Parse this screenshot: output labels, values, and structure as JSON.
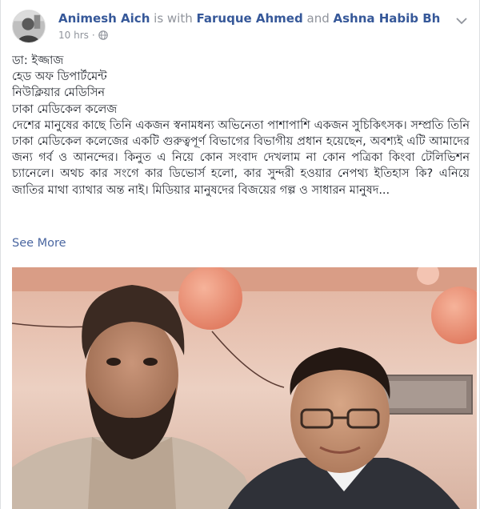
{
  "post": {
    "author": "Animesh Aich",
    "with_text": " is with ",
    "tagged_1": "Faruque Ahmed",
    "and_text": " and ",
    "tagged_2": "Ashna Habib Bhabna",
    "period": ".",
    "time": "10 hrs",
    "dot": "·",
    "lines": [
      "ডা: ইজ্জাজ",
      "হেড অফ ডিপার্টমেন্ট",
      "নিউক্লিয়ার মেডিসিন",
      "ঢাকা মেডিকেল কলেজ"
    ],
    "body": "দেশের মানুষের কাছে তিনি একজন স্বনামধন্য অভিনেতা পাশাপাশি একজন সুচিকিৎসক। সম্প্রতি তিনি ঢাকা মেডিকেল কলেজের একটি গুরুত্বপূর্ণ বিভাগের বিভাগীয় প্রধান হয়েছেন, অবশ্যই এটি আমাদের জন্য গর্ব ও আনন্দের। কিনুত এ নিয়ে কোন সংবাদ দেখলাম না কোন পত্রিকা কিংবা টেলিভিশন চ্যানেলে। অথচ কার সংগে কার ডিভোর্স হলো, কার সুন্দরী হওয়ার নেপথ্য ইতিহাস কি? এনিয়ে জাতির মাথা ব্যাথার অন্ত নাই। মিডিয়ার মানুষদের বিজয়ের গল্প ও সাধারন মানুষদ...",
    "see_more": "See More"
  },
  "icons": {
    "privacy": "globe-icon",
    "menu": "chevron-down-icon",
    "avatar": "avatar-photo"
  },
  "colors": {
    "link": "#365899",
    "meta": "#90949c",
    "text": "#1d2129",
    "see_more": "#4b67a1"
  }
}
